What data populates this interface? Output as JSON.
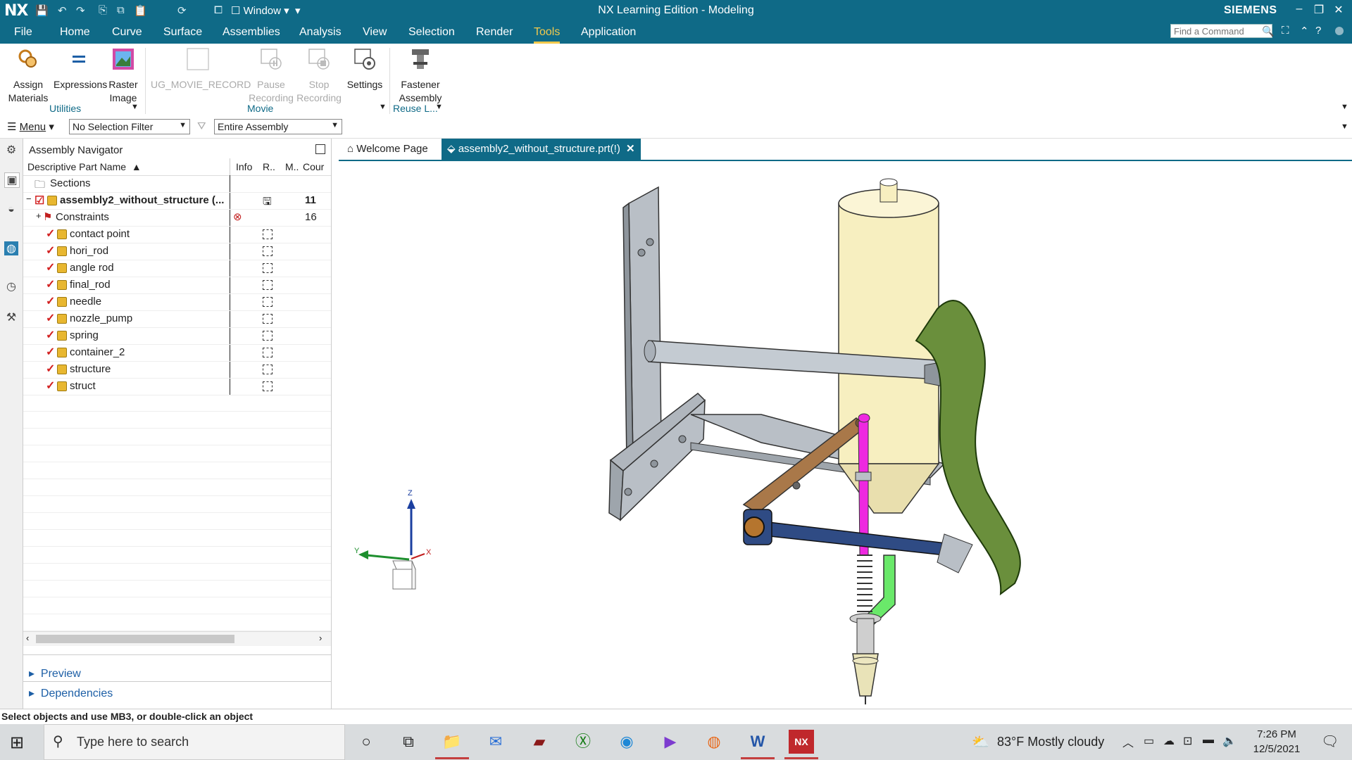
{
  "titlebar": {
    "logo": "NX",
    "window_menu": "Window",
    "title": "NX Learning Edition - Modeling",
    "brand": "SIEMENS"
  },
  "menu": {
    "tabs": [
      "File",
      "Home",
      "Curve",
      "Surface",
      "Assemblies",
      "Analysis",
      "View",
      "Selection",
      "Render",
      "Tools",
      "Application"
    ],
    "active": "Tools",
    "find_placeholder": "Find a Command"
  },
  "ribbon": {
    "buttons": {
      "assign_materials": "Assign\nMaterials",
      "expressions": "Expressions",
      "raster_image": "Raster\nImage",
      "movie_record": "UG_MOVIE_RECORD",
      "pause_recording": "Pause\nRecording",
      "stop_recording": "Stop\nRecording",
      "settings": "Settings",
      "fastener_assembly": "Fastener\nAssembly"
    },
    "groups": {
      "utilities": "Utilities",
      "movie": "Movie",
      "reuse": "Reuse L..."
    }
  },
  "selection_bar": {
    "menu_label": "Menu",
    "filter": "No Selection Filter",
    "scope": "Entire Assembly"
  },
  "navigator": {
    "title": "Assembly Navigator",
    "columns": [
      "Descriptive Part Name",
      "Info",
      "R..",
      "M..",
      "Cour"
    ],
    "sections": "Sections",
    "root": {
      "name": "assembly2_without_structure (...",
      "count": "11"
    },
    "constraints": {
      "name": "Constraints",
      "count": "16"
    },
    "parts": [
      "contact point",
      "hori_rod",
      "angle rod",
      "final_rod",
      "needle",
      "nozzle_pump",
      "spring",
      "container_2",
      "structure",
      "struct"
    ],
    "preview": "Preview",
    "dependencies": "Dependencies"
  },
  "graphics_tabs": {
    "welcome": "Welcome Page",
    "part": "assembly2_without_structure.prt(!)"
  },
  "triad": {
    "z": "Z",
    "y": "Y",
    "x": "X"
  },
  "status": "Select objects and use MB3, or double-click an object",
  "taskbar": {
    "search_placeholder": "Type here to search",
    "weather": "83°F  Mostly cloudy",
    "time": "7:26 PM",
    "date": "12/5/2021"
  }
}
